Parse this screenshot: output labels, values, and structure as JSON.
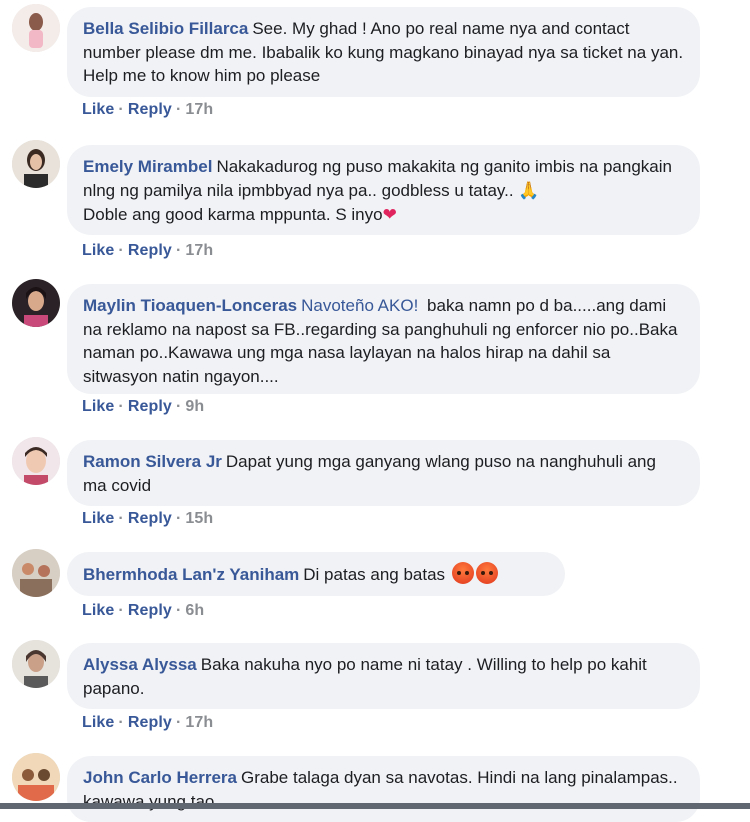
{
  "comments": [
    {
      "author": "Bella Selibio Fillarca",
      "text": "See. My ghad ! Ano po real name nya and contact number please dm me. Ibabalik ko kung magkano binayad nya sa ticket na yan. Help me to know him po please",
      "like": "Like",
      "reply": "Reply",
      "time": "17h"
    },
    {
      "author": "Emely Mirambel",
      "text": "Nakakadurog ng puso makakita ng ganito imbis na pangkain nlng ng pamilya nila ipmbbyad nya pa.. godbless u tatay..",
      "emoji1": "🙏",
      "text2": "Doble ang good karma mppunta. S inyo",
      "emoji2": "❤",
      "like": "Like",
      "reply": "Reply",
      "time": "17h"
    },
    {
      "author": "Maylin Tioaquen-Lonceras",
      "tag": "Navoteño AKO!",
      "text": "baka namn po d ba.....ang dami na reklamo na napost sa FB..regarding sa panghuhuli ng enforcer nio po..Baka naman po..Kawawa ung mga nasa laylayan na halos hirap na dahil sa sitwasyon natin ngayon....",
      "like": "Like",
      "reply": "Reply",
      "time": "9h"
    },
    {
      "author": "Ramon Silvera Jr",
      "text": "Dapat yung mga ganyang wlang puso na nanghuhuli ang ma covid",
      "like": "Like",
      "reply": "Reply",
      "time": "15h"
    },
    {
      "author": "Bhermhoda Lan'z Yaniham",
      "text": "Di patas ang batas",
      "emoji": "angry-face-icon",
      "like": "Like",
      "reply": "Reply",
      "time": "6h"
    },
    {
      "author": "Alyssa Alyssa",
      "text": "Baka nakuha nyo po name ni tatay . Willing to help po kahit papano.",
      "like": "Like",
      "reply": "Reply",
      "time": "17h"
    },
    {
      "author": "John Carlo Herrera",
      "text": "Grabe talaga dyan sa navotas. Hindi na lang pinalampas.. kawawa yung tao."
    }
  ],
  "separator": "·",
  "colors": {
    "author": "#385898",
    "bubble": "#f0f2f5",
    "meta": "#65676b"
  }
}
